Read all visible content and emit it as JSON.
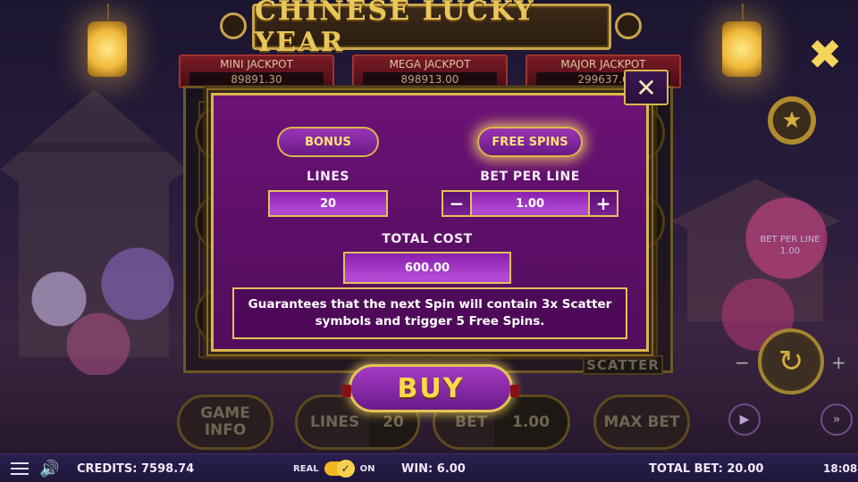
{
  "game": {
    "title": "CHINESE LUCKY YEAR"
  },
  "jackpots": [
    {
      "label": "MINI JACKPOT",
      "value": "89891.30"
    },
    {
      "label": "MEGA JACKPOT",
      "value": "898913.00"
    },
    {
      "label": "MAJOR JACKPOT",
      "value": "299637.6"
    }
  ],
  "side_panel": {
    "close_icon": "✖",
    "star_icon": "★",
    "bet_per_line_label": "BET PER LINE",
    "bet_per_line_value": "1.00",
    "spin_icon": "↻",
    "minus": "−",
    "plus": "+",
    "auto_icon": "▶",
    "turbo_icon": "»"
  },
  "reels": {
    "scatter_label": "SCATTER"
  },
  "controls": {
    "game_info": "GAME INFO",
    "lines_label": "LINES",
    "lines_value": "20",
    "bet_label": "BET",
    "bet_value": "1.00",
    "max_bet": "MAX BET"
  },
  "modal": {
    "close_icon": "✕",
    "tabs": [
      "BONUS",
      "FREE SPINS"
    ],
    "active_tab": "FREE SPINS",
    "lines_label": "LINES",
    "lines_value": "20",
    "bet_per_line_label": "BET PER LINE",
    "bet_per_line_value": "1.00",
    "minus": "−",
    "plus": "+",
    "total_cost_label": "TOTAL  COST",
    "total_cost_value": "600.00",
    "description": "Guarantees that the next Spin will contain 3x Scatter symbols and trigger 5 Free Spins.",
    "buy_label": "BUY"
  },
  "status_bar": {
    "credits": "CREDITS: 7598.74",
    "real_label": "REAL",
    "on_label": "ON",
    "win": "WIN: 6.00",
    "total_bet": "TOTAL BET: 20.00",
    "clock": "18:08"
  },
  "colors": {
    "gold": "#d8b84a",
    "modal_purple": "#6c1276",
    "buy_text": "#ffd84a",
    "status_bar": "#2a1f4e"
  }
}
